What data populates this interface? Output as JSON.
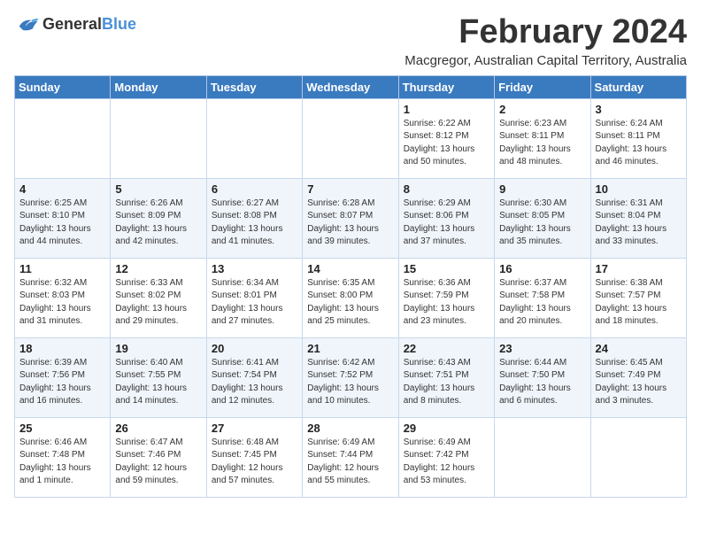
{
  "header": {
    "logo_general": "General",
    "logo_blue": "Blue",
    "month_title": "February 2024",
    "subtitle": "Macgregor, Australian Capital Territory, Australia"
  },
  "weekdays": [
    "Sunday",
    "Monday",
    "Tuesday",
    "Wednesday",
    "Thursday",
    "Friday",
    "Saturday"
  ],
  "weeks": [
    [
      {
        "day": "",
        "detail": ""
      },
      {
        "day": "",
        "detail": ""
      },
      {
        "day": "",
        "detail": ""
      },
      {
        "day": "",
        "detail": ""
      },
      {
        "day": "1",
        "detail": "Sunrise: 6:22 AM\nSunset: 8:12 PM\nDaylight: 13 hours\nand 50 minutes."
      },
      {
        "day": "2",
        "detail": "Sunrise: 6:23 AM\nSunset: 8:11 PM\nDaylight: 13 hours\nand 48 minutes."
      },
      {
        "day": "3",
        "detail": "Sunrise: 6:24 AM\nSunset: 8:11 PM\nDaylight: 13 hours\nand 46 minutes."
      }
    ],
    [
      {
        "day": "4",
        "detail": "Sunrise: 6:25 AM\nSunset: 8:10 PM\nDaylight: 13 hours\nand 44 minutes."
      },
      {
        "day": "5",
        "detail": "Sunrise: 6:26 AM\nSunset: 8:09 PM\nDaylight: 13 hours\nand 42 minutes."
      },
      {
        "day": "6",
        "detail": "Sunrise: 6:27 AM\nSunset: 8:08 PM\nDaylight: 13 hours\nand 41 minutes."
      },
      {
        "day": "7",
        "detail": "Sunrise: 6:28 AM\nSunset: 8:07 PM\nDaylight: 13 hours\nand 39 minutes."
      },
      {
        "day": "8",
        "detail": "Sunrise: 6:29 AM\nSunset: 8:06 PM\nDaylight: 13 hours\nand 37 minutes."
      },
      {
        "day": "9",
        "detail": "Sunrise: 6:30 AM\nSunset: 8:05 PM\nDaylight: 13 hours\nand 35 minutes."
      },
      {
        "day": "10",
        "detail": "Sunrise: 6:31 AM\nSunset: 8:04 PM\nDaylight: 13 hours\nand 33 minutes."
      }
    ],
    [
      {
        "day": "11",
        "detail": "Sunrise: 6:32 AM\nSunset: 8:03 PM\nDaylight: 13 hours\nand 31 minutes."
      },
      {
        "day": "12",
        "detail": "Sunrise: 6:33 AM\nSunset: 8:02 PM\nDaylight: 13 hours\nand 29 minutes."
      },
      {
        "day": "13",
        "detail": "Sunrise: 6:34 AM\nSunset: 8:01 PM\nDaylight: 13 hours\nand 27 minutes."
      },
      {
        "day": "14",
        "detail": "Sunrise: 6:35 AM\nSunset: 8:00 PM\nDaylight: 13 hours\nand 25 minutes."
      },
      {
        "day": "15",
        "detail": "Sunrise: 6:36 AM\nSunset: 7:59 PM\nDaylight: 13 hours\nand 23 minutes."
      },
      {
        "day": "16",
        "detail": "Sunrise: 6:37 AM\nSunset: 7:58 PM\nDaylight: 13 hours\nand 20 minutes."
      },
      {
        "day": "17",
        "detail": "Sunrise: 6:38 AM\nSunset: 7:57 PM\nDaylight: 13 hours\nand 18 minutes."
      }
    ],
    [
      {
        "day": "18",
        "detail": "Sunrise: 6:39 AM\nSunset: 7:56 PM\nDaylight: 13 hours\nand 16 minutes."
      },
      {
        "day": "19",
        "detail": "Sunrise: 6:40 AM\nSunset: 7:55 PM\nDaylight: 13 hours\nand 14 minutes."
      },
      {
        "day": "20",
        "detail": "Sunrise: 6:41 AM\nSunset: 7:54 PM\nDaylight: 13 hours\nand 12 minutes."
      },
      {
        "day": "21",
        "detail": "Sunrise: 6:42 AM\nSunset: 7:52 PM\nDaylight: 13 hours\nand 10 minutes."
      },
      {
        "day": "22",
        "detail": "Sunrise: 6:43 AM\nSunset: 7:51 PM\nDaylight: 13 hours\nand 8 minutes."
      },
      {
        "day": "23",
        "detail": "Sunrise: 6:44 AM\nSunset: 7:50 PM\nDaylight: 13 hours\nand 6 minutes."
      },
      {
        "day": "24",
        "detail": "Sunrise: 6:45 AM\nSunset: 7:49 PM\nDaylight: 13 hours\nand 3 minutes."
      }
    ],
    [
      {
        "day": "25",
        "detail": "Sunrise: 6:46 AM\nSunset: 7:48 PM\nDaylight: 13 hours\nand 1 minute."
      },
      {
        "day": "26",
        "detail": "Sunrise: 6:47 AM\nSunset: 7:46 PM\nDaylight: 12 hours\nand 59 minutes."
      },
      {
        "day": "27",
        "detail": "Sunrise: 6:48 AM\nSunset: 7:45 PM\nDaylight: 12 hours\nand 57 minutes."
      },
      {
        "day": "28",
        "detail": "Sunrise: 6:49 AM\nSunset: 7:44 PM\nDaylight: 12 hours\nand 55 minutes."
      },
      {
        "day": "29",
        "detail": "Sunrise: 6:49 AM\nSunset: 7:42 PM\nDaylight: 12 hours\nand 53 minutes."
      },
      {
        "day": "",
        "detail": ""
      },
      {
        "day": "",
        "detail": ""
      }
    ]
  ]
}
